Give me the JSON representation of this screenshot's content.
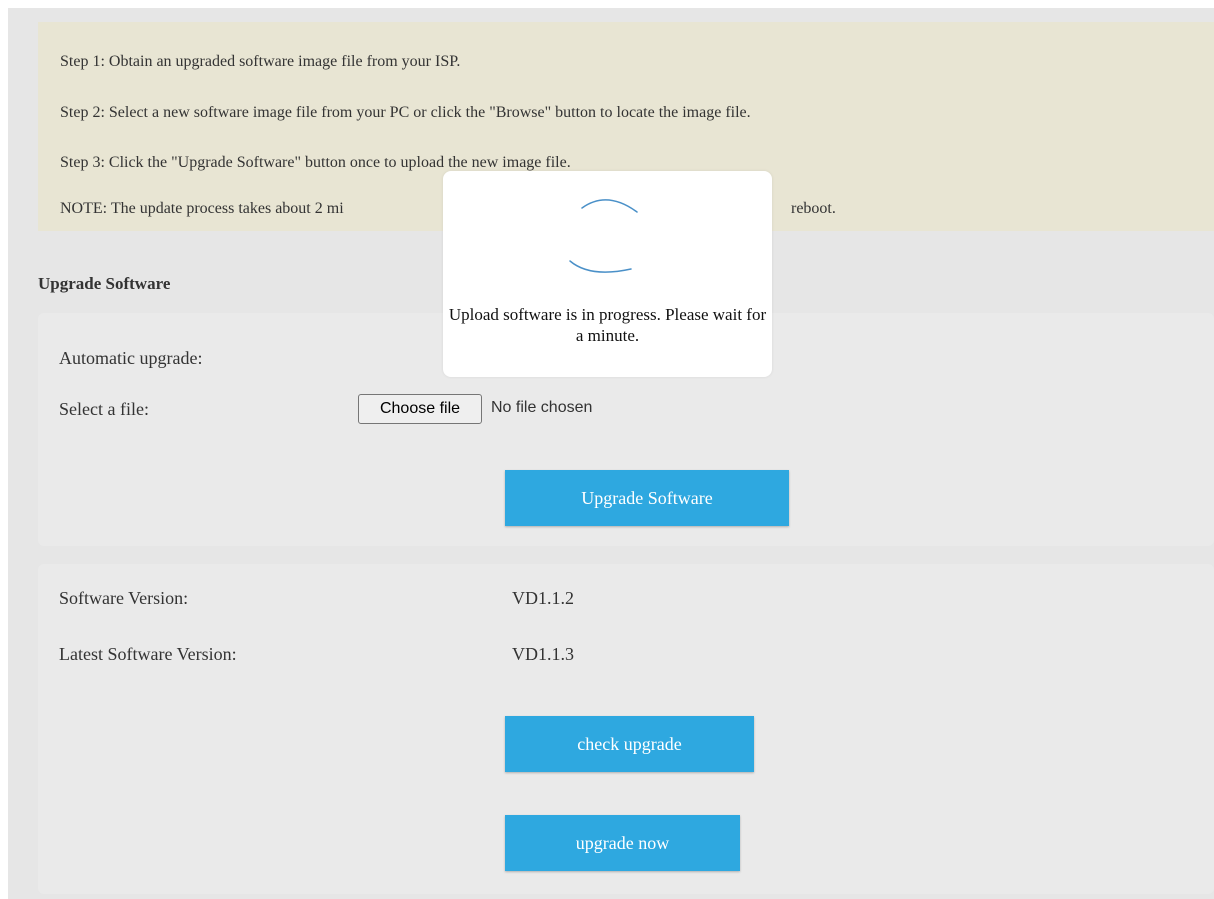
{
  "notes": {
    "step1": "Step 1: Obtain an upgraded software image file from your ISP.",
    "step2": "Step 2: Select a new software image file from your PC or click the \"Browse\" button to locate the image file.",
    "step3": "Step 3: Click the \"Upgrade Software\" button once to upload the new image file.",
    "note_start": "NOTE: The update process takes about 2 mi",
    "note_end": "reboot."
  },
  "section_title": "Upgrade Software",
  "upgrade_panel": {
    "automatic_label": "Automatic upgrade:",
    "file_label": "Select a file:",
    "choose_file_label": "Choose file",
    "file_status": "No file chosen",
    "upgrade_button": "Upgrade Software"
  },
  "version_panel": {
    "software_version_label": "Software Version:",
    "software_version_value": "VD1.1.2",
    "latest_version_label": "Latest Software Version:",
    "latest_version_value": "VD1.1.3",
    "check_upgrade_button": "check upgrade",
    "upgrade_now_button": "upgrade now"
  },
  "modal": {
    "message": "Upload software is in progress. Please wait for a minute."
  },
  "colors": {
    "button_blue": "#2ea8e0",
    "notes_background": "#e8e5d3",
    "panel_background": "#eaeaea",
    "spinner_blue": "#4a90c8"
  }
}
